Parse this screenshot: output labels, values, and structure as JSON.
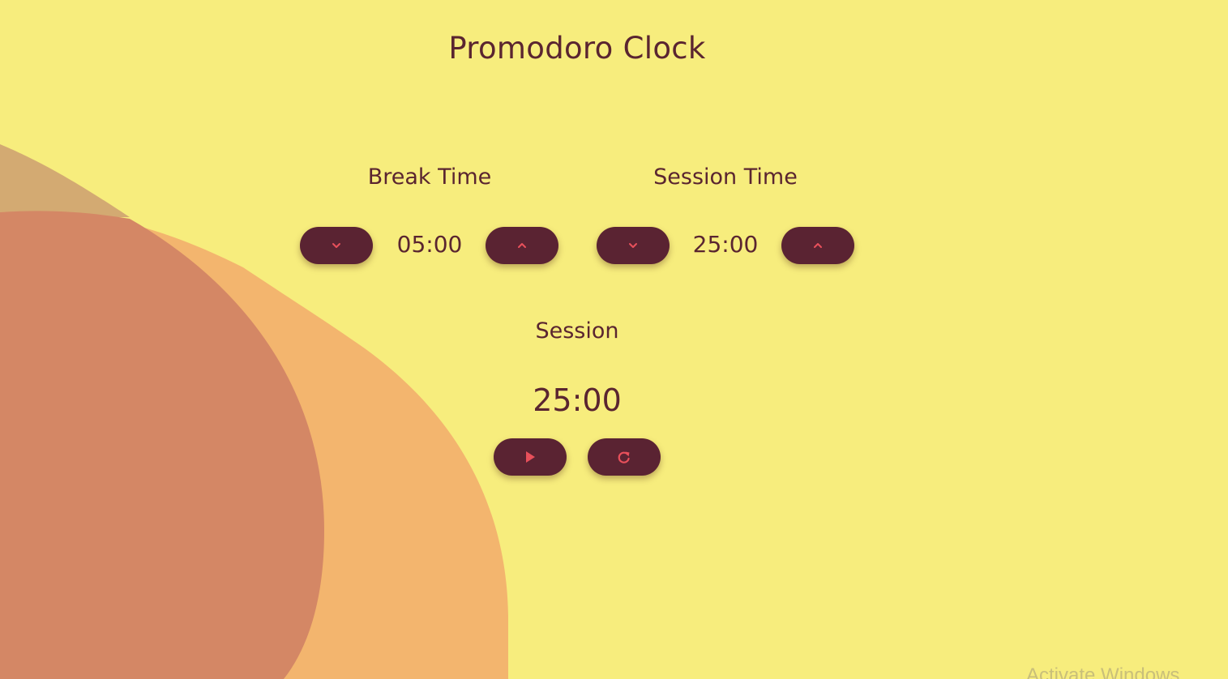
{
  "app": {
    "title": "Promodoro Clock"
  },
  "break": {
    "label": "Break Time",
    "value": "05:00",
    "decrement_icon": "chevron-down-icon",
    "increment_icon": "chevron-up-icon"
  },
  "session": {
    "label": "Session Time",
    "value": "25:00",
    "decrement_icon": "chevron-down-icon",
    "increment_icon": "chevron-up-icon"
  },
  "timer": {
    "label": "Session",
    "value": "25:00",
    "start_icon": "play-icon",
    "reset_icon": "refresh-icon"
  },
  "watermark": {
    "text": "Activate Windows"
  },
  "colors": {
    "background": "#f7ed7d",
    "text": "#5a2530",
    "button": "#5a2332",
    "button_icon": "#e8505b",
    "blob_light": "#f3b56e",
    "blob_dark": "#d48765",
    "blob_tan": "#d3aa72"
  }
}
